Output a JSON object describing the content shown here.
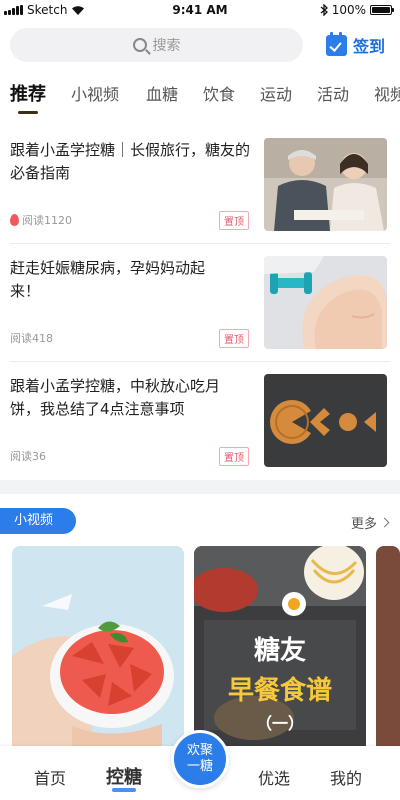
{
  "status_bar": {
    "carrier": "Sketch",
    "time": "9:41 AM",
    "battery": "100%",
    "battery_level": 1.0
  },
  "header": {
    "search": {
      "placeholder": "搜索",
      "icon": "search-icon"
    },
    "signin": {
      "label": "签到",
      "icon": "calendar-check-icon"
    }
  },
  "tabs": [
    {
      "label": "推荐",
      "active": true
    },
    {
      "label": "小视频"
    },
    {
      "label": "血糖"
    },
    {
      "label": "饮食"
    },
    {
      "label": "运动"
    },
    {
      "label": "活动"
    },
    {
      "label": "视频"
    }
  ],
  "articles": [
    {
      "title": "跟着小孟学控糖｜长假旅行，糖友的必备指南",
      "reads": "阅读1120",
      "badge": "置顶",
      "hot": true
    },
    {
      "title": "赶走妊娠糖尿病，孕妈妈动起来！",
      "reads": "阅读418",
      "badge": "置顶"
    },
    {
      "title": "跟着小孟学控糖，中秋放心吃月饼，我总结了4点注意事项",
      "reads": "阅读36",
      "badge": "置顶"
    }
  ],
  "video_section": {
    "title": "小视频",
    "more": "更多",
    "cards": [
      {
        "caption_line1": ""
      },
      {
        "caption_line1": "糖友",
        "caption_line2": "早餐食谱",
        "caption_line3": "（一）"
      }
    ]
  },
  "bottom_nav": {
    "items": [
      {
        "label": "首页"
      },
      {
        "label": "控糖",
        "active": true
      },
      {
        "label": "优选"
      },
      {
        "label": "我的"
      }
    ],
    "center_label_1": "欢聚",
    "center_label_2": "一糖"
  },
  "colors": {
    "accent": "#2b7de9",
    "pin": "#e05a6d"
  }
}
